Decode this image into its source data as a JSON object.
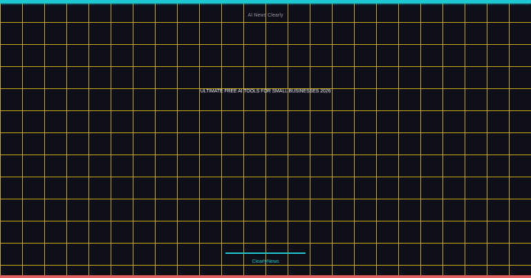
{
  "site_name": "AI News Clearly",
  "headline": "ULTIMATE FREE AI TOOLS FOR SMALL BUSINESSES 2026",
  "brand": "ClearlyNews",
  "colors": {
    "background": "#0e0e16",
    "grid": "#d2b41e",
    "accent_top": "#1ec8d2",
    "accent_bottom": "#e06060",
    "brand": "#1ec8d2"
  }
}
